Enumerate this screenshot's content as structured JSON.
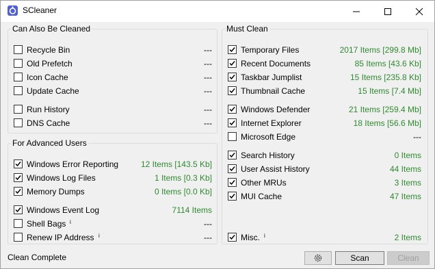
{
  "window": {
    "title": "SCleaner",
    "app_icon": "scleaner-app-icon",
    "controls": [
      "minimize-icon",
      "maximize-icon",
      "close-icon"
    ]
  },
  "also_group": {
    "title": "Can Also Be Cleaned",
    "items": [
      {
        "label": "Recycle Bin",
        "value": "---",
        "checked": false
      },
      {
        "label": "Old Prefetch",
        "value": "---",
        "checked": false
      },
      {
        "label": "Icon Cache",
        "value": "---",
        "checked": false
      },
      {
        "label": "Update Cache",
        "value": "---",
        "checked": false
      },
      {
        "label": "Run History",
        "value": "---",
        "checked": false
      },
      {
        "label": "DNS Cache",
        "value": "---",
        "checked": false
      }
    ]
  },
  "advanced_group": {
    "title": "For Advanced Users",
    "items": [
      {
        "label": "Windows Error Reporting",
        "value": "12 Items [143.5 Kb]",
        "checked": true
      },
      {
        "label": "Windows Log Files",
        "value": "1 Items [0.3 Kb]",
        "checked": true
      },
      {
        "label": "Memory Dumps",
        "value": "0 Items [0.0 Kb]",
        "checked": true
      },
      {
        "label": "Windows Event Log",
        "value": "7114 Items",
        "checked": true
      },
      {
        "label": "Shell Bags",
        "info": "i",
        "value": "---",
        "checked": false
      },
      {
        "label": "Renew IP Address",
        "info": "i",
        "value": "---",
        "checked": false
      }
    ]
  },
  "must_group": {
    "title": "Must Clean",
    "items": [
      {
        "label": "Temporary Files",
        "value": "2017 Items [299.8 Mb]",
        "checked": true
      },
      {
        "label": "Recent Documents",
        "value": "85 Items [43.6 Kb]",
        "checked": true
      },
      {
        "label": "Taskbar Jumplist",
        "value": "15 Items [235.8 Kb]",
        "checked": true
      },
      {
        "label": "Thumbnail Cache",
        "value": "15 Items [7.4 Mb]",
        "checked": true
      },
      {
        "label": "Windows Defender",
        "value": "21 Items [259.4 Mb]",
        "checked": true
      },
      {
        "label": "Internet Explorer",
        "value": "18 Items [56.6 Mb]",
        "checked": true
      },
      {
        "label": "Microsoft Edge",
        "value": "---",
        "checked": false
      },
      {
        "label": "Search History",
        "value": "0 Items",
        "checked": true
      },
      {
        "label": "User Assist History",
        "value": "44 Items",
        "checked": true
      },
      {
        "label": "Other MRUs",
        "value": "3 Items",
        "checked": true
      },
      {
        "label": "MUI Cache",
        "value": "47 Items",
        "checked": true
      },
      {
        "label": "Misc.",
        "info": "i",
        "value": "2 Items",
        "checked": true
      }
    ]
  },
  "footer": {
    "status": "Clean Complete",
    "settings_icon": "gear-icon",
    "scan_label": "Scan",
    "clean_label": "Clean"
  },
  "colors": {
    "value_green": "#2e8b2e",
    "app_icon_blue": "#4f5fd4"
  }
}
